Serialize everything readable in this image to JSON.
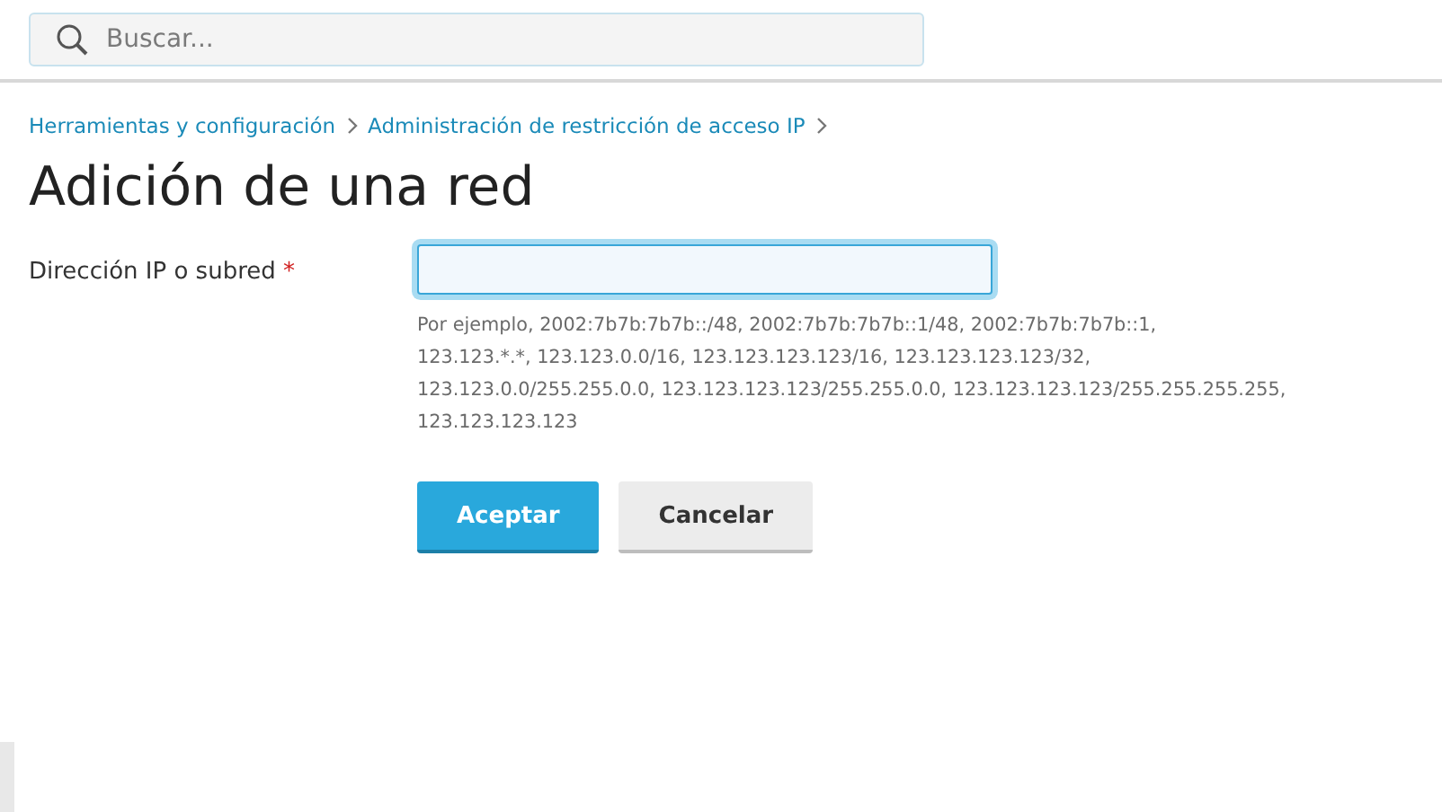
{
  "search": {
    "placeholder": "Buscar..."
  },
  "breadcrumbs": [
    "Herramientas y configuración",
    "Administración de restricción de acceso IP"
  ],
  "title": "Adición de una red",
  "field": {
    "label": "Dirección IP o subred",
    "required_mark": "*",
    "focused": true,
    "hint_lines": [
      "Por ejemplo, 2002:7b7b:7b7b::/48, 2002:7b7b:7b7b::1/48, 2002:7b7b:7b7b::1,",
      "123.123.*.*, 123.123.0.0/16, 123.123.123.123/16, 123.123.123.123/32,",
      "123.123.0.0/255.255.0.0, 123.123.123.123/255.255.0.0, 123.123.123.123/255.255.255.255,",
      "123.123.123.123"
    ]
  },
  "buttons": [
    {
      "label": "Aceptar",
      "kind": "primary"
    },
    {
      "label": "Cancelar",
      "kind": "secondary"
    }
  ]
}
